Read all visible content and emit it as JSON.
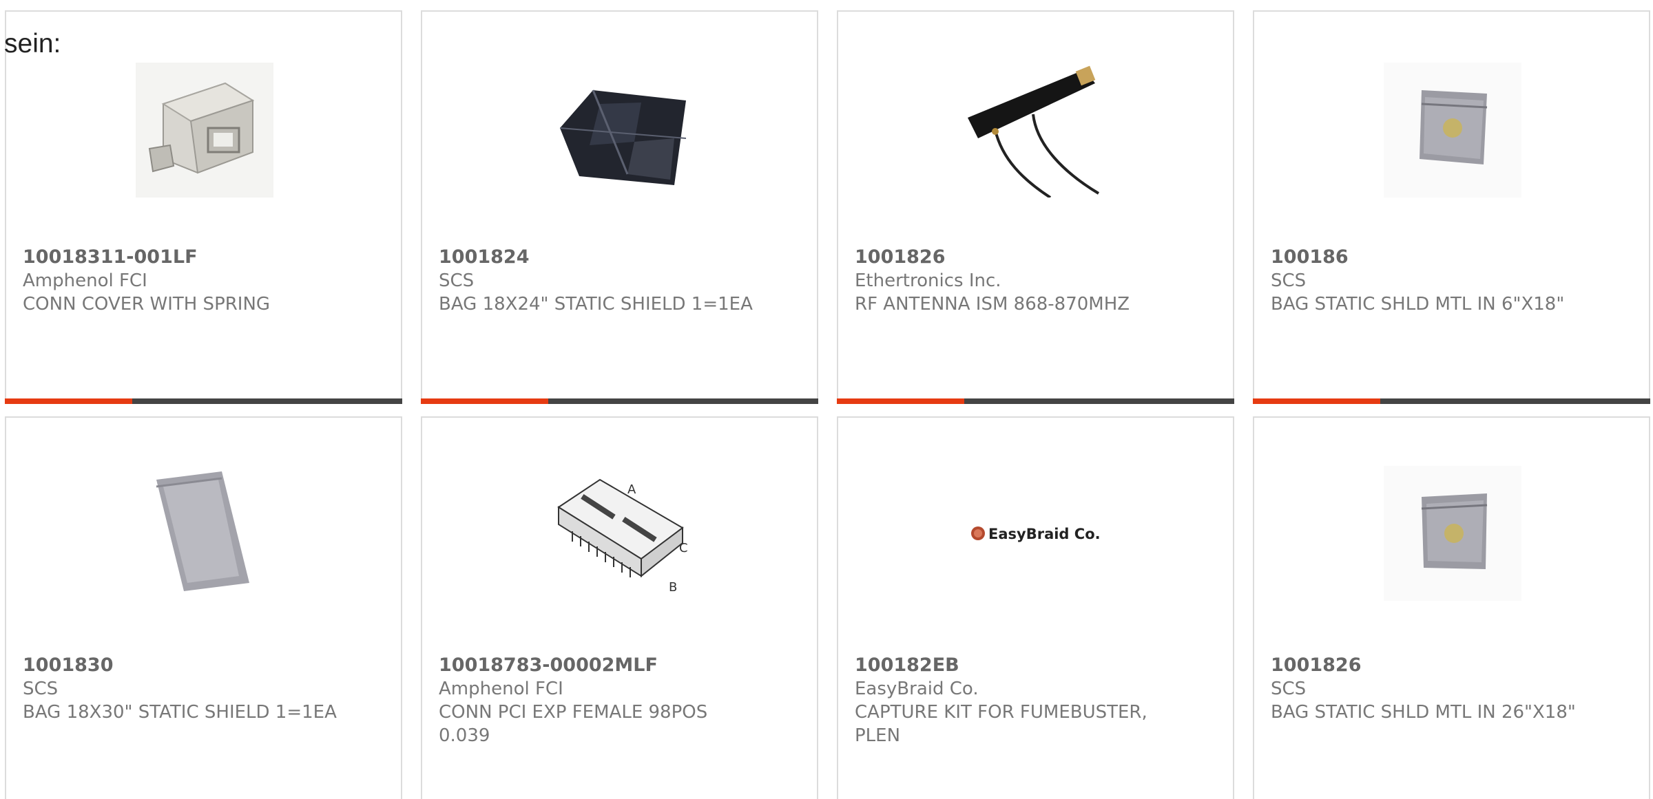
{
  "lead_text": "sein:",
  "colors": {
    "accent": "#e63b12",
    "bar_track": "#444444",
    "border": "#dcdcdc",
    "text": "#777777"
  },
  "products": [
    {
      "part_number": "10018311-001LF",
      "manufacturer": "Amphenol FCI",
      "description": "CONN COVER WITH SPRING",
      "image": "connector-cover-image",
      "progress": 0.32
    },
    {
      "part_number": "1001824",
      "manufacturer": "SCS",
      "description": "BAG 18X24\" STATIC SHIELD 1=1EA",
      "image": "static-bag-image",
      "progress": 0.32
    },
    {
      "part_number": "1001826",
      "manufacturer": "Ethertronics Inc.",
      "description": "RF ANTENNA ISM 868-870MHZ",
      "image": "antenna-image",
      "progress": 0.32
    },
    {
      "part_number": "100186",
      "manufacturer": "SCS",
      "description": "BAG STATIC SHLD MTL IN 6\"X18\"",
      "image": "static-bag-small-image",
      "progress": 0.32
    },
    {
      "part_number": "1001830",
      "manufacturer": "SCS",
      "description": "BAG 18X30\" STATIC SHIELD 1=1EA",
      "image": "static-bag-tilted-image",
      "progress": null
    },
    {
      "part_number": "10018783-00002MLF",
      "manufacturer": "Amphenol FCI",
      "description": "CONN PCI EXP FEMALE 98POS 0.039",
      "image": "pci-connector-drawing",
      "drawing_labels": [
        "A",
        "B",
        "C"
      ],
      "progress": null
    },
    {
      "part_number": "100182EB",
      "manufacturer": "EasyBraid Co.",
      "description": "CAPTURE KIT FOR FUMEBUSTER, PLEN",
      "image": "easybraid-logo",
      "logo_text": "EasyBraid Co.",
      "progress": null
    },
    {
      "part_number": "1001826",
      "manufacturer": "SCS",
      "description": "BAG STATIC SHLD MTL IN 26\"X18\"",
      "image": "static-bag-small-image",
      "progress": null
    }
  ]
}
